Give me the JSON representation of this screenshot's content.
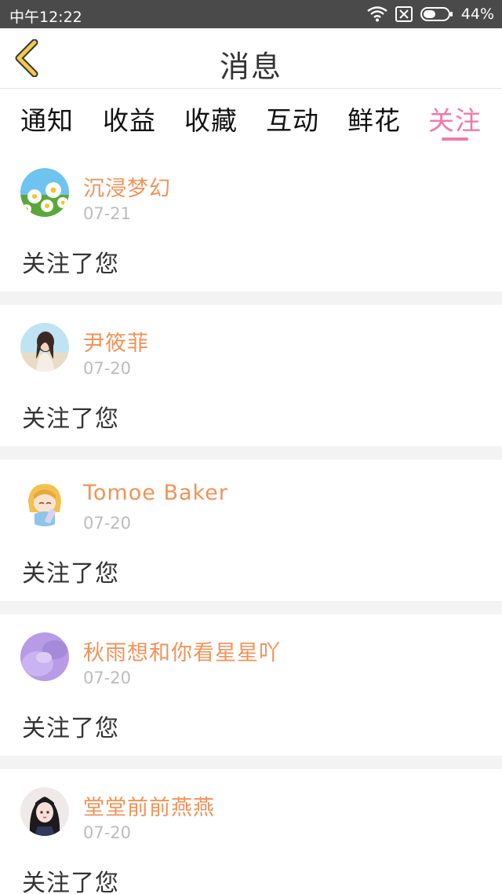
{
  "status_bar": {
    "time": "中午12:22",
    "battery": "44%"
  },
  "header": {
    "title": "消息",
    "back_icon": "chevron-left-icon",
    "back_color": "#f2c94c"
  },
  "tabs": [
    {
      "label": "通知"
    },
    {
      "label": "收益"
    },
    {
      "label": "收藏"
    },
    {
      "label": "互动"
    },
    {
      "label": "鲜花"
    },
    {
      "label": "关注",
      "active": true
    }
  ],
  "colors": {
    "accent": "#f07aa6",
    "username": "#f0935a",
    "date": "#bcbcbc"
  },
  "messages": [
    {
      "name": "沉浸梦幻",
      "date": "07-21",
      "text": "关注了您",
      "avatar": "daisy-flowers-avatar"
    },
    {
      "name": "尹筱菲",
      "date": "07-20",
      "text": "关注了您",
      "avatar": "girl-beach-avatar"
    },
    {
      "name": "Tomoe Baker",
      "date": "07-20",
      "text": "关注了您",
      "avatar": "anime-girl-avatar"
    },
    {
      "name": "秋雨想和你看星星吖",
      "date": "07-20",
      "text": "关注了您",
      "avatar": "purple-cat-avatar"
    },
    {
      "name": "堂堂前前燕燕",
      "date": "07-20",
      "text": "关注了您",
      "avatar": "dark-hair-girl-avatar"
    }
  ]
}
